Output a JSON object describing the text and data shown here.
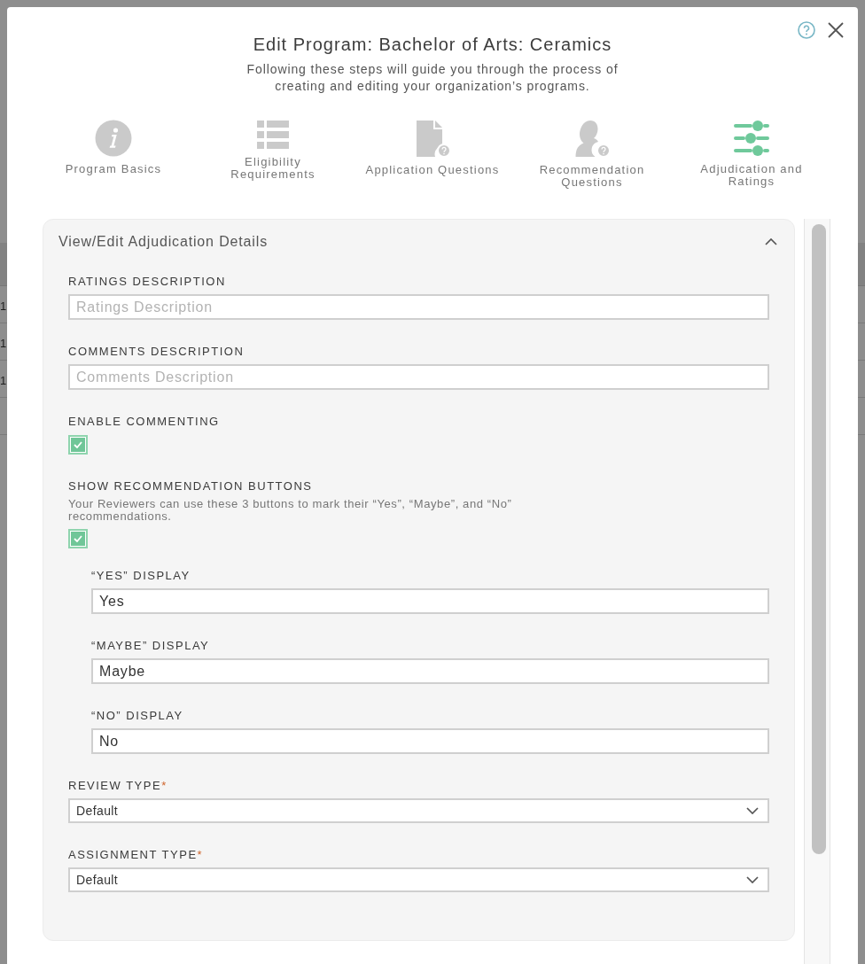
{
  "dialog": {
    "title": "Edit Program: Bachelor of Arts: Ceramics",
    "subtitle": "Following these steps will guide you through the process of creating and editing your organization’s programs."
  },
  "steps": [
    {
      "kind": "info",
      "label": "Program Basics",
      "selected": false
    },
    {
      "kind": "list",
      "label": "Eligibility Requirements",
      "selected": false
    },
    {
      "kind": "document",
      "label": "Application Questions",
      "selected": false
    },
    {
      "kind": "person",
      "label": "Recommendation Questions",
      "selected": false
    },
    {
      "kind": "sliders",
      "label": "Adjudication and Ratings",
      "selected": true
    }
  ],
  "section": {
    "title": "View/Edit Adjudication Details",
    "expanded": true,
    "fields": [
      {
        "kind": "text",
        "label": "RATINGS DESCRIPTION",
        "placeholder": "Ratings Description"
      },
      {
        "kind": "text",
        "label": "COMMENTS DESCRIPTION",
        "placeholder": "Comments Description"
      },
      {
        "kind": "checkbox",
        "label": "ENABLE COMMENTING",
        "checked": true
      },
      {
        "kind": "checkbox",
        "label": "SHOW RECOMMENDATION BUTTONS",
        "description": "Your Reviewers can use these 3 buttons to mark their “Yes”, “Maybe”, and “No” recommendations.",
        "checked": true,
        "children": [
          {
            "kind": "text",
            "label": "“YES” DISPLAY",
            "value": "Yes"
          },
          {
            "kind": "text",
            "label": "“MAYBE” DISPLAY",
            "value": "Maybe"
          },
          {
            "kind": "text",
            "label": "“NO” DISPLAY",
            "value": "No"
          }
        ]
      },
      {
        "kind": "select",
        "label": "REVIEW TYPE",
        "required_mark": "*",
        "value": "Default"
      },
      {
        "kind": "select",
        "label": "ASSIGNMENT TYPE",
        "required_mark": "*",
        "value": "Default"
      }
    ]
  },
  "background_table": {
    "rows": [
      {
        "column_1": "1"
      },
      {
        "column_1": "1"
      },
      {
        "column_1": "1"
      }
    ]
  }
}
